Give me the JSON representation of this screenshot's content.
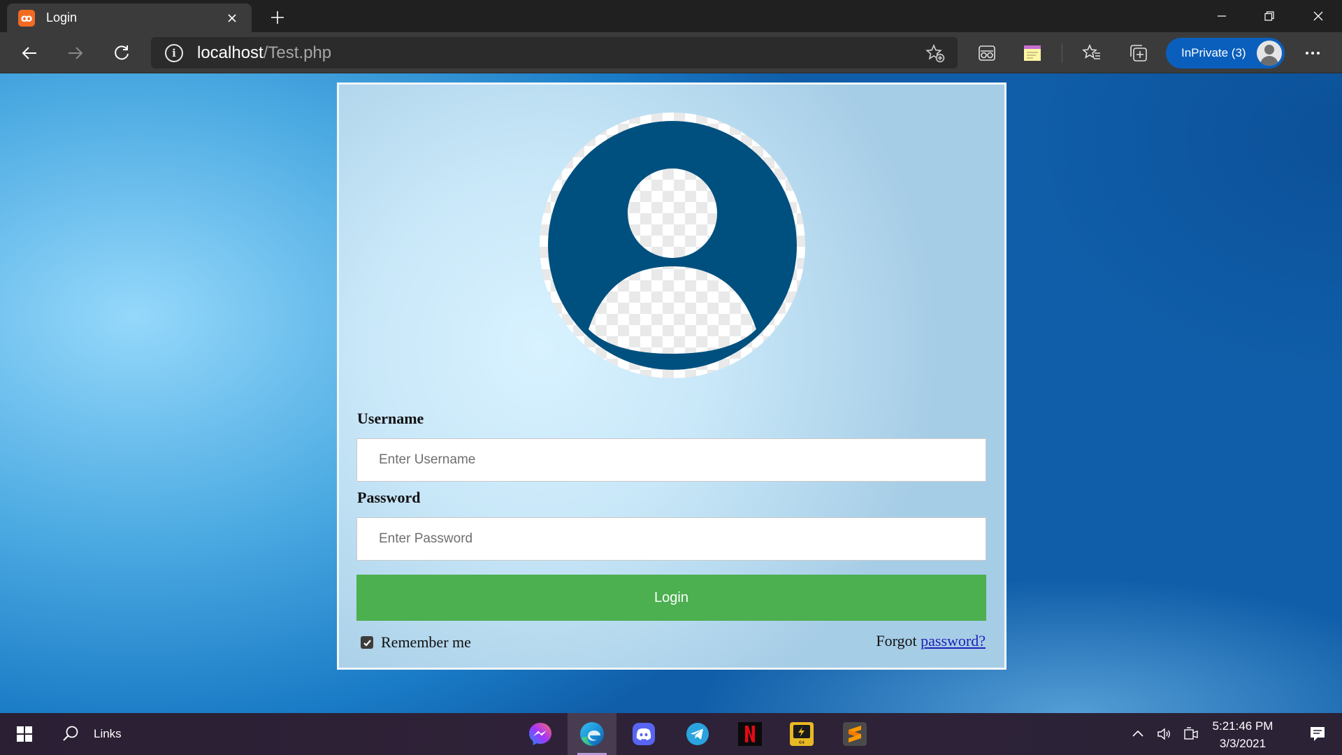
{
  "browser": {
    "tab_title": "Login",
    "favicon_text": "ඞ",
    "address_host": "localhost",
    "address_path": "/Test.php",
    "inprivate_label": "InPrivate (3)",
    "accent_color": "#0a5fbd"
  },
  "page": {
    "username_label": "Username",
    "username_placeholder": "Enter Username",
    "password_label": "Password",
    "password_placeholder": "Enter Password",
    "login_button": "Login",
    "remember_label": "Remember me",
    "remember_checked": true,
    "forgot_prefix": "Forgot",
    "forgot_link": "password?",
    "button_color": "#4caf50"
  },
  "taskbar": {
    "search_label": "Links",
    "apps": [
      "messenger-icon",
      "edge-icon",
      "discord-icon",
      "telegram-icon",
      "netflix-icon",
      "x64dbg-icon",
      "sublime-text-icon"
    ],
    "active_app": "edge-icon",
    "time": "5:21:46 PM",
    "date": "3/3/2021"
  }
}
